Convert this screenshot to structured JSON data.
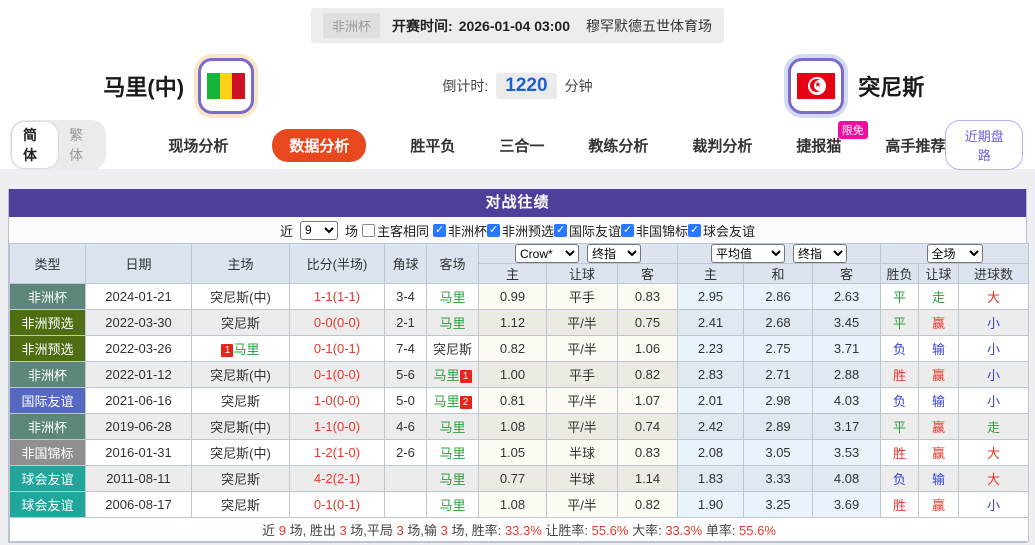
{
  "top_bar": {
    "league": "非洲杯",
    "kickoff_label": "开赛时间:",
    "kickoff_time": "2026-01-04 03:00",
    "venue": "穆罕默德五世体育场"
  },
  "match": {
    "home": {
      "name": "马里(中)",
      "flag": "mali-flag"
    },
    "away": {
      "name": "突尼斯",
      "flag": "tunisia-flag"
    },
    "countdown": {
      "label": "倒计时:",
      "value": "1220",
      "unit": "分钟"
    }
  },
  "nav": {
    "lang": {
      "simplified": "简体",
      "traditional": "繁体"
    },
    "items": [
      {
        "label": "现场分析",
        "active": false
      },
      {
        "label": "数据分析",
        "active": true
      },
      {
        "label": "胜平负",
        "active": false
      },
      {
        "label": "三合一",
        "active": false
      },
      {
        "label": "教练分析",
        "active": false
      },
      {
        "label": "裁判分析",
        "active": false
      },
      {
        "label": "捷报猫",
        "active": false,
        "badge": "限免"
      },
      {
        "label": "高手推荐",
        "active": false
      }
    ],
    "right_button": "近期盘路"
  },
  "h2h": {
    "title": "对战往绩",
    "filters": {
      "near_label": "近",
      "count": "9",
      "games_label": "场",
      "same_venue_label": "主客相同",
      "same_venue_checked": false,
      "leagues": [
        {
          "label": "非洲杯",
          "checked": true
        },
        {
          "label": "非洲预选",
          "checked": true
        },
        {
          "label": "国际友谊",
          "checked": true
        },
        {
          "label": "非国锦标",
          "checked": true
        },
        {
          "label": "球会友谊",
          "checked": true
        }
      ]
    },
    "selectors": {
      "handicap_src": "Crow*",
      "handicap_kind": "终指",
      "europe_src": "平均值",
      "europe_kind": "终指",
      "scope": "全场"
    },
    "columns": [
      "类型",
      "日期",
      "主场",
      "比分(半场)",
      "角球",
      "客场",
      "主",
      "让球",
      "客",
      "主",
      "和",
      "客",
      "胜负",
      "让球",
      "进球数"
    ],
    "type_colors": {
      "非洲杯": "#5c8779",
      "非洲预选": "#4d6e11",
      "国际友谊": "#5668c0",
      "非国锦标": "#8f8f8f",
      "球会友谊": "#20a69a"
    },
    "text_colors": {
      "red": "#e6392b",
      "green": "#2e9e3c",
      "blue": "#3742d6",
      "dark": "#333333"
    },
    "rows": [
      {
        "type": "非洲杯",
        "date": "2024-01-21",
        "home": "突尼斯(中)",
        "home_color": "dark",
        "score": "1-1",
        "half": "(1-1)",
        "corner": "3-4",
        "away": "马里",
        "away_color": "green",
        "handicap": [
          "0.99",
          "平手",
          "0.83"
        ],
        "europe": [
          "2.95",
          "2.86",
          "2.63"
        ],
        "outcome": [
          {
            "t": "平",
            "c": "green"
          },
          {
            "t": "走",
            "c": "green"
          },
          {
            "t": "大",
            "c": "red"
          }
        ]
      },
      {
        "type": "非洲预选",
        "date": "2022-03-30",
        "home": "突尼斯",
        "home_color": "dark",
        "score": "0-0",
        "half": "(0-0)",
        "corner": "2-1",
        "away": "马里",
        "away_color": "green",
        "handicap": [
          "1.12",
          "平/半",
          "0.75"
        ],
        "europe": [
          "2.41",
          "2.68",
          "3.45"
        ],
        "outcome": [
          {
            "t": "平",
            "c": "green"
          },
          {
            "t": "赢",
            "c": "red"
          },
          {
            "t": "小",
            "c": "blue"
          }
        ]
      },
      {
        "type": "非洲预选",
        "date": "2022-03-26",
        "home": "马里",
        "home_color": "green",
        "home_badge": {
          "num": "1",
          "pos": "before"
        },
        "score": "0-1",
        "half": "(0-1)",
        "corner": "7-4",
        "away": "突尼斯",
        "away_color": "dark",
        "handicap": [
          "0.82",
          "平/半",
          "1.06"
        ],
        "europe": [
          "2.23",
          "2.75",
          "3.71"
        ],
        "outcome": [
          {
            "t": "负",
            "c": "blue"
          },
          {
            "t": "输",
            "c": "blue"
          },
          {
            "t": "小",
            "c": "blue"
          }
        ]
      },
      {
        "type": "非洲杯",
        "date": "2022-01-12",
        "home": "突尼斯(中)",
        "home_color": "dark",
        "score": "0-1",
        "half": "(0-0)",
        "corner": "5-6",
        "away": "马里",
        "away_color": "green",
        "away_badge": {
          "num": "1",
          "pos": "after"
        },
        "handicap": [
          "1.00",
          "平手",
          "0.82"
        ],
        "europe": [
          "2.83",
          "2.71",
          "2.88"
        ],
        "outcome": [
          {
            "t": "胜",
            "c": "red"
          },
          {
            "t": "赢",
            "c": "red"
          },
          {
            "t": "小",
            "c": "blue"
          }
        ]
      },
      {
        "type": "国际友谊",
        "date": "2021-06-16",
        "home": "突尼斯",
        "home_color": "dark",
        "score": "1-0",
        "half": "(0-0)",
        "corner": "5-0",
        "away": "马里",
        "away_color": "green",
        "away_badge": {
          "num": "2",
          "pos": "after"
        },
        "handicap": [
          "0.81",
          "平/半",
          "1.07"
        ],
        "europe": [
          "2.01",
          "2.98",
          "4.03"
        ],
        "outcome": [
          {
            "t": "负",
            "c": "blue"
          },
          {
            "t": "输",
            "c": "blue"
          },
          {
            "t": "小",
            "c": "blue"
          }
        ]
      },
      {
        "type": "非洲杯",
        "date": "2019-06-28",
        "home": "突尼斯(中)",
        "home_color": "dark",
        "score": "1-1",
        "half": "(0-0)",
        "corner": "4-6",
        "away": "马里",
        "away_color": "green",
        "handicap": [
          "1.08",
          "平/半",
          "0.74"
        ],
        "europe": [
          "2.42",
          "2.89",
          "3.17"
        ],
        "outcome": [
          {
            "t": "平",
            "c": "green"
          },
          {
            "t": "赢",
            "c": "red"
          },
          {
            "t": "走",
            "c": "green"
          }
        ]
      },
      {
        "type": "非国锦标",
        "date": "2016-01-31",
        "home": "突尼斯(中)",
        "home_color": "dark",
        "score": "1-2",
        "half": "(1-0)",
        "corner": "2-6",
        "away": "马里",
        "away_color": "green",
        "handicap": [
          "1.05",
          "半球",
          "0.83"
        ],
        "europe": [
          "2.08",
          "3.05",
          "3.53"
        ],
        "outcome": [
          {
            "t": "胜",
            "c": "red"
          },
          {
            "t": "赢",
            "c": "red"
          },
          {
            "t": "大",
            "c": "red"
          }
        ]
      },
      {
        "type": "球会友谊",
        "date": "2011-08-11",
        "home": "突尼斯",
        "home_color": "dark",
        "score": "4-2",
        "half": "(2-1)",
        "corner": "",
        "away": "马里",
        "away_color": "green",
        "handicap": [
          "0.77",
          "半球",
          "1.14"
        ],
        "europe": [
          "1.83",
          "3.33",
          "4.08"
        ],
        "outcome": [
          {
            "t": "负",
            "c": "blue"
          },
          {
            "t": "输",
            "c": "blue"
          },
          {
            "t": "大",
            "c": "red"
          }
        ]
      },
      {
        "type": "球会友谊",
        "date": "2006-08-17",
        "home": "突尼斯",
        "home_color": "dark",
        "score": "0-1",
        "half": "(0-1)",
        "corner": "",
        "away": "马里",
        "away_color": "green",
        "handicap": [
          "1.08",
          "平/半",
          "0.82"
        ],
        "europe": [
          "1.90",
          "3.25",
          "3.69"
        ],
        "outcome": [
          {
            "t": "胜",
            "c": "red"
          },
          {
            "t": "赢",
            "c": "red"
          },
          {
            "t": "小",
            "c": "blue"
          }
        ]
      }
    ],
    "summary": [
      {
        "text": "近 "
      },
      {
        "text": "9",
        "red": true
      },
      {
        "text": " 场, 胜出 "
      },
      {
        "text": "3",
        "red": true
      },
      {
        "text": " 场,平局 "
      },
      {
        "text": "3",
        "red": true
      },
      {
        "text": " 场,输 "
      },
      {
        "text": "3",
        "red": true
      },
      {
        "text": " 场, 胜率: "
      },
      {
        "text": "33.3%",
        "red": true
      },
      {
        "text": " 让胜率: "
      },
      {
        "text": "55.6%",
        "red": true
      },
      {
        "text": " 大率: "
      },
      {
        "text": "33.3%",
        "red": true
      },
      {
        "text": " 单率: "
      },
      {
        "text": "55.6%",
        "red": true
      }
    ]
  }
}
